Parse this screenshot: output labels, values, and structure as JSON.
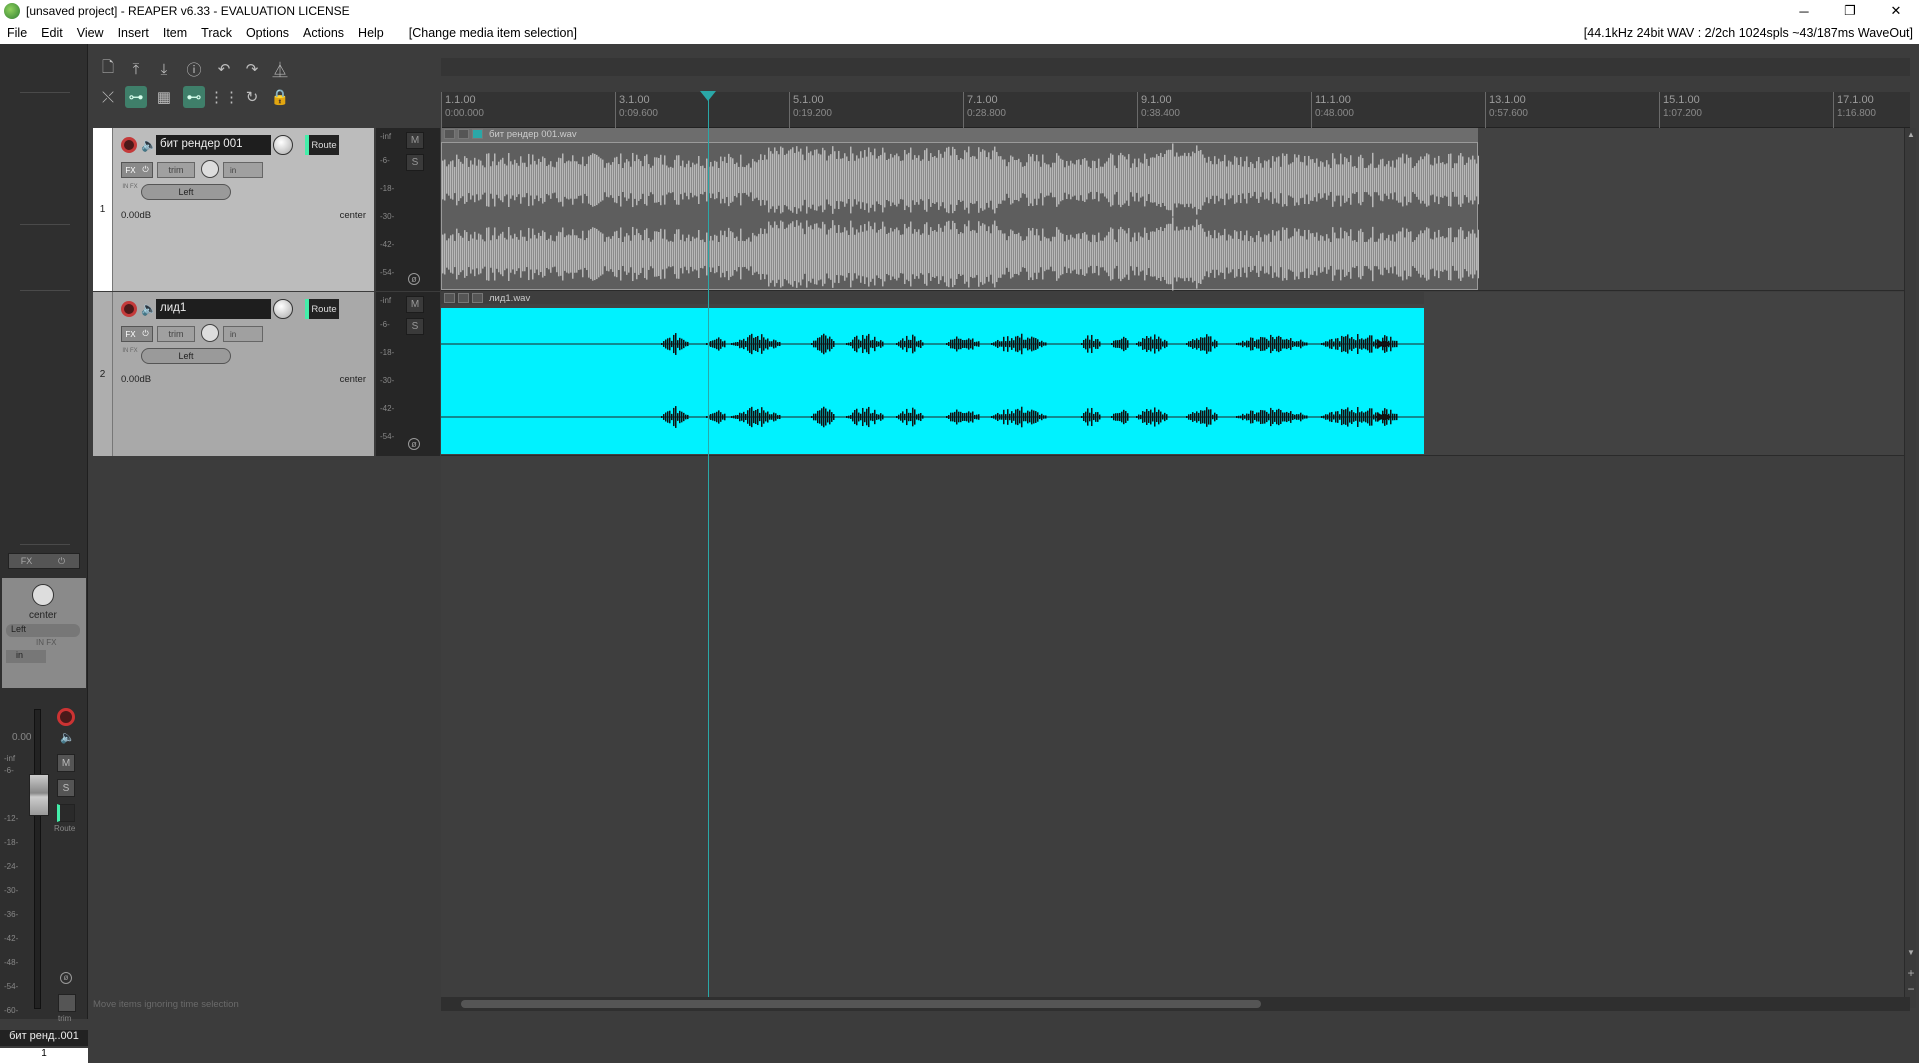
{
  "window": {
    "title": "[unsaved project] - REAPER v6.33 - EVALUATION LICENSE",
    "minimize": "─",
    "restore": "❐",
    "close": "✕"
  },
  "menu": {
    "items": [
      "File",
      "Edit",
      "View",
      "Insert",
      "Item",
      "Track",
      "Options",
      "Actions",
      "Help"
    ],
    "hint": "[Change media item selection]",
    "audio_status": "[44.1kHz 24bit WAV : 2/2ch 1024spls ~43/187ms WaveOut]"
  },
  "toolbar": {
    "icons": [
      "new-project-icon",
      "open-icon",
      "save-icon",
      "info-icon",
      "undo-icon",
      "redo-icon",
      "metronome-icon",
      "ripple-icon",
      "link-icon",
      "grid-icon",
      "snap-icon",
      "grid-lines-icon",
      "loop-icon",
      "lock-icon"
    ]
  },
  "ruler": {
    "marks": [
      {
        "bar": "1.1.00",
        "time": "0:00.000"
      },
      {
        "bar": "3.1.00",
        "time": "0:09.600"
      },
      {
        "bar": "5.1.00",
        "time": "0:19.200"
      },
      {
        "bar": "7.1.00",
        "time": "0:28.800"
      },
      {
        "bar": "9.1.00",
        "time": "0:38.400"
      },
      {
        "bar": "11.1.00",
        "time": "0:48.000"
      },
      {
        "bar": "13.1.00",
        "time": "0:57.600"
      },
      {
        "bar": "15.1.00",
        "time": "1:07.200"
      },
      {
        "bar": "17.1.00",
        "time": "1:16.800"
      }
    ]
  },
  "tracks": [
    {
      "number": "1",
      "name": "бит рендер 001",
      "route": "Route",
      "fx": "FX",
      "trim": "trim",
      "input": "in",
      "infx": "IN FX",
      "channel": "Left",
      "volume": "0.00dB",
      "pan": "center",
      "meter_scale": [
        "-inf",
        "-6-",
        "-18-",
        "-30-",
        "-42-",
        "-54-"
      ],
      "mute": "M",
      "solo": "S",
      "item": {
        "name": "бит рендер 001.wav"
      }
    },
    {
      "number": "2",
      "name": "лид1",
      "route": "Route",
      "fx": "FX",
      "trim": "trim",
      "input": "in",
      "infx": "IN FX",
      "channel": "Left",
      "volume": "0.00dB",
      "pan": "center",
      "meter_scale": [
        "-inf",
        "-6-",
        "-18-",
        "-30-",
        "-42-",
        "-54-"
      ],
      "mute": "M",
      "solo": "S",
      "item": {
        "name": "лид1.wav",
        "color": "#00f2ff"
      }
    }
  ],
  "mixer": {
    "fx": "FX",
    "pan": "center",
    "channel": "Left",
    "infx": "IN FX",
    "input": "in",
    "volume": "0.00",
    "scale": [
      "-inf",
      "-6-",
      "-12-",
      "-18-",
      "-24-",
      "-30-",
      "-36-",
      "-42-",
      "-48-",
      "-54-",
      "-60-"
    ],
    "mute": "M",
    "solo": "S",
    "route": "Route",
    "trim": "trim",
    "track_name": "бит ренд..001",
    "track_number": "1"
  },
  "status_line": "Move items ignoring time selection"
}
